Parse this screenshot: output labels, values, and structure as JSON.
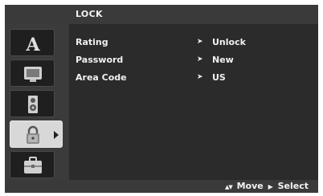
{
  "menu": {
    "title": "LOCK"
  },
  "settings": [
    {
      "label": "Rating",
      "value": "Unlock"
    },
    {
      "label": "Password",
      "value": "New"
    },
    {
      "label": "Area Code",
      "value": "US"
    }
  ],
  "footer": {
    "move_symbol": "▲▼",
    "move_label": "Move",
    "select_symbol": "▶",
    "select_label": "Select"
  },
  "tabs": [
    {
      "icon": "language-icon"
    },
    {
      "icon": "display-icon"
    },
    {
      "icon": "audio-icon"
    },
    {
      "icon": "lock-icon",
      "selected": true
    },
    {
      "icon": "others-icon"
    }
  ]
}
